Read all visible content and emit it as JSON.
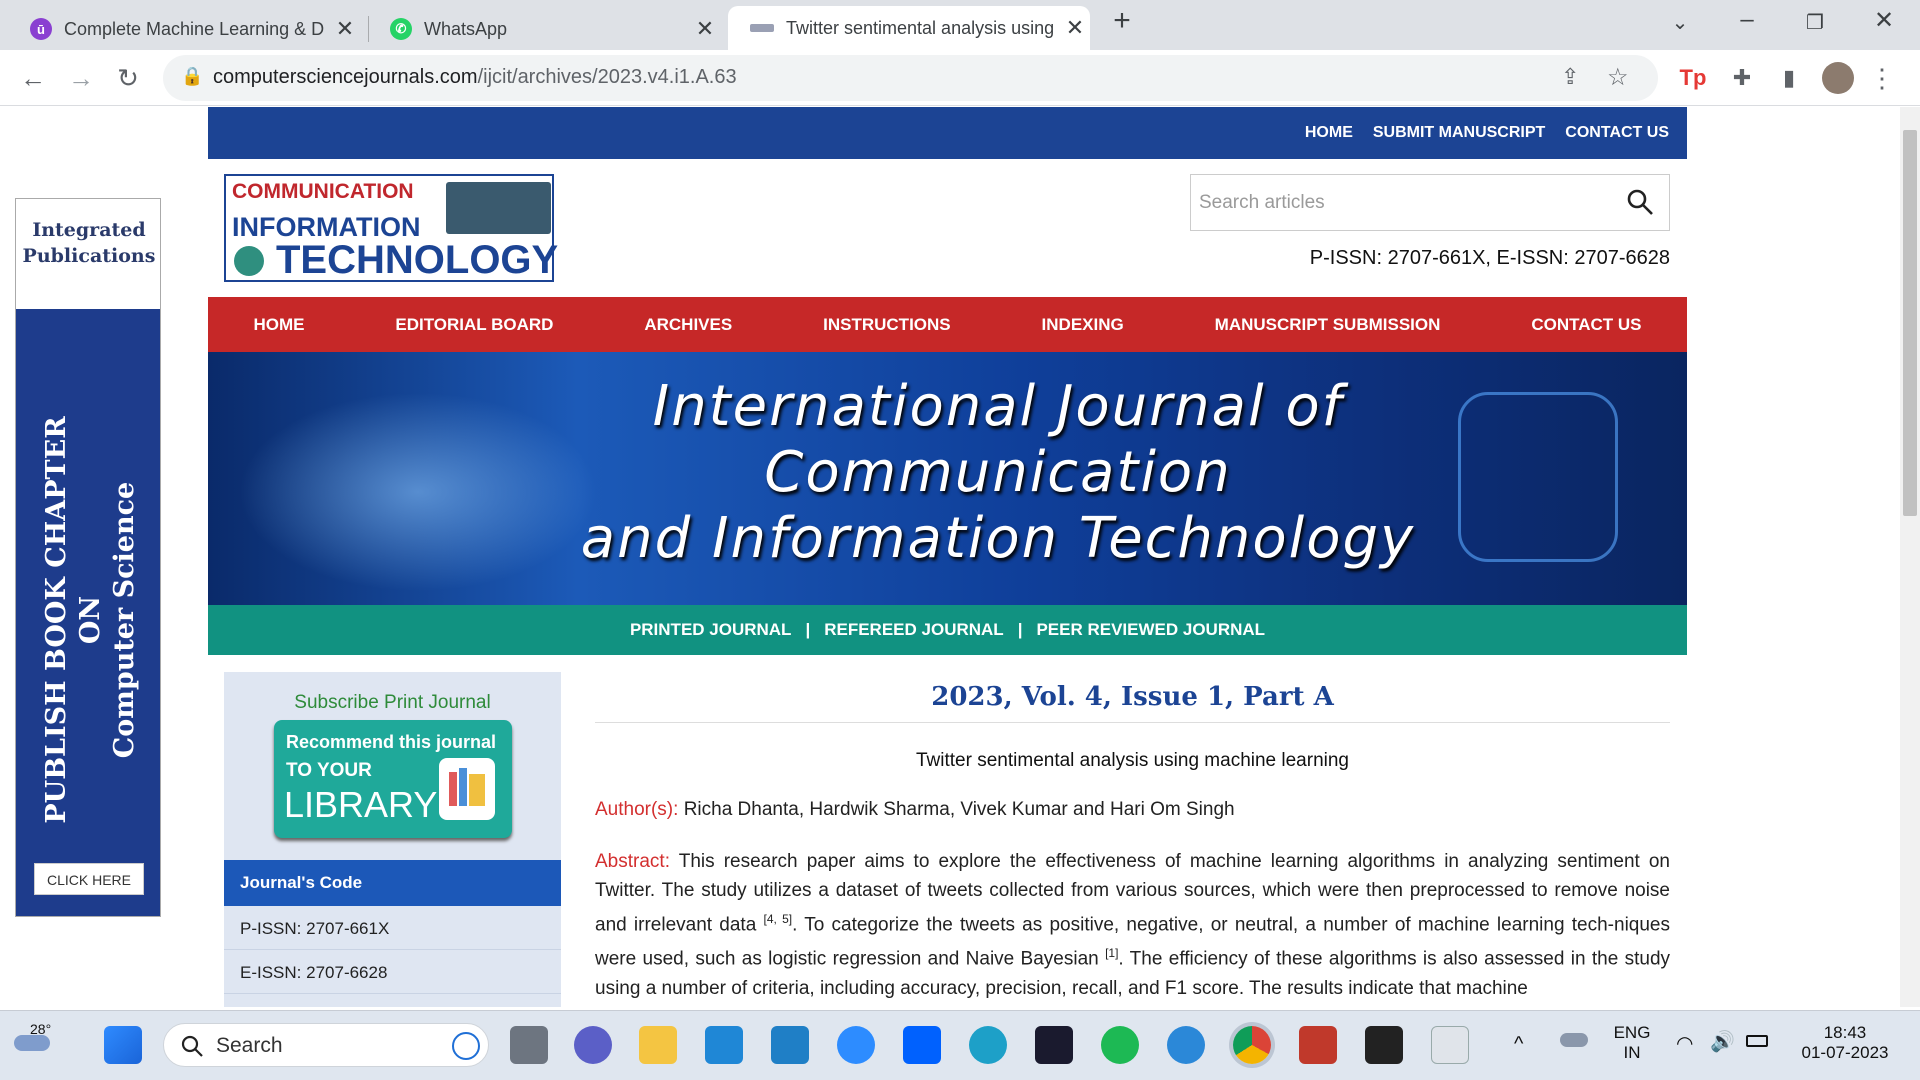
{
  "browser": {
    "tabs": [
      {
        "title": "Complete Machine Learning & D",
        "active": false
      },
      {
        "title": "WhatsApp",
        "active": false
      },
      {
        "title": "Twitter sentimental analysis using",
        "active": true
      }
    ],
    "url_host": "computersciencejournals.com",
    "url_path": "/ijcit/archives/2023.v4.i1.A.63"
  },
  "ad": {
    "publisher_line1": "Integrated",
    "publisher_line2": "Publications",
    "vertical_line1": "PUBLISH BOOK CHAPTER",
    "vertical_line2": "ON",
    "vertical_line3": "Computer Science",
    "cta": "CLICK HERE"
  },
  "site": {
    "top_nav": [
      "HOME",
      "SUBMIT MANUSCRIPT",
      "CONTACT US"
    ],
    "logo": {
      "line1": "COMMUNICATION",
      "line2": "INFORMATION",
      "line3": "TECHNOLOGY"
    },
    "search_placeholder": "Search articles",
    "issn": "P-ISSN: 2707-661X, E-ISSN: 2707-6628",
    "main_nav": [
      "HOME",
      "EDITORIAL BOARD",
      "ARCHIVES",
      "INSTRUCTIONS",
      "INDEXING",
      "MANUSCRIPT SUBMISSION",
      "CONTACT US"
    ],
    "banner": {
      "line1": "International Journal of",
      "line2": "Communication",
      "line3": "and Information Technology"
    },
    "tags": [
      "PRINTED JOURNAL",
      "REFEREED JOURNAL",
      "PEER REVIEWED JOURNAL"
    ],
    "tag_separator": "|"
  },
  "sidebar": {
    "subscribe_heading": "Subscribe Print Journal",
    "badge_line1": "Recommend this journal",
    "badge_line2": "TO YOUR",
    "badge_line3": "LIBRARY",
    "journal_code_heading": "Journal's Code",
    "rows": [
      "P-ISSN: 2707-661X",
      "E-ISSN: 2707-6628"
    ]
  },
  "article": {
    "issue": "2023, Vol. 4, Issue 1, Part A",
    "title": "Twitter sentimental analysis using machine learning",
    "authors_label": "Author(s):",
    "authors": "Richa Dhanta, Hardwik Sharma, Vivek Kumar and Hari Om Singh",
    "abstract_label": "Abstract:",
    "abstract_p1": "This research paper aims to explore the effectiveness of machine learning algorithms in analyzing sentiment on Twitter. The study utilizes a dataset of tweets collected from various sources, which were then preprocessed to remove noise and irrelevant data",
    "ref1": "[4, 5]",
    "abstract_p2": ". To categorize the tweets as positive, negative, or neutral, a number of machine learning tech-niques were used, such as logistic regression and Naive Bayesian",
    "ref2": "[1]",
    "abstract_p3": ". The efficiency of these algorithms is also assessed in the study using a number of criteria, including accuracy, precision, recall, and F1 score. The results indicate that machine"
  },
  "taskbar": {
    "weather_temp": "28°",
    "search_label": "Search",
    "lang1": "ENG",
    "lang2": "IN",
    "time": "18:43",
    "date": "01-07-2023"
  },
  "colors": {
    "nav_blue": "#1c4494",
    "nav_red": "#c62828",
    "teal": "#119281",
    "label_red": "#d32f2f"
  }
}
